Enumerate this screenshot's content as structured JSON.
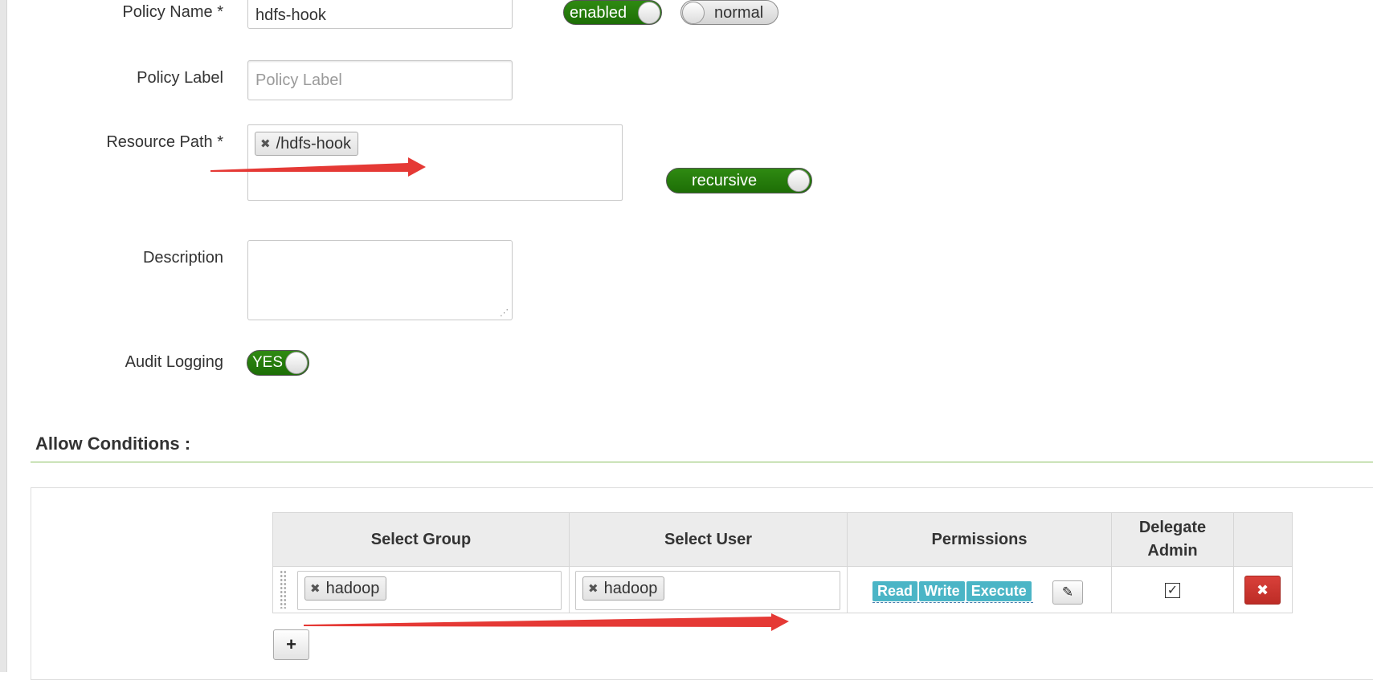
{
  "form": {
    "policy_name": {
      "label": "Policy Name *",
      "value": "hdfs-hook"
    },
    "policy_status_toggle": {
      "label": "enabled",
      "state": "on"
    },
    "policy_type_toggle": {
      "label": "normal",
      "state": "off"
    },
    "policy_label": {
      "label": "Policy Label",
      "placeholder": "Policy Label"
    },
    "resource_path": {
      "label": "Resource Path *",
      "tags": [
        "/hdfs-hook"
      ]
    },
    "recursive_toggle": {
      "label": "recursive",
      "state": "on"
    },
    "description": {
      "label": "Description",
      "value": ""
    },
    "audit_logging": {
      "label": "Audit Logging",
      "toggle_label": "YES",
      "state": "on"
    }
  },
  "allow_conditions": {
    "title": "Allow Conditions :",
    "columns": [
      "Select Group",
      "Select User",
      "Permissions",
      "Delegate Admin",
      ""
    ],
    "rows": [
      {
        "group_tags": [
          "hadoop"
        ],
        "user_tags": [
          "hadoop"
        ],
        "permissions": [
          "Read",
          "Write",
          "Execute"
        ],
        "delegate_admin_checked": true
      }
    ],
    "add_button_label": "+"
  },
  "colors": {
    "toggle_on": "#2f8a12",
    "permission_badge": "#4bb5c6",
    "delete_button": "#d9403a",
    "section_rule": "#8bbf60",
    "annotation_arrow": "#e53935"
  },
  "icons": {
    "remove_tag": "close-icon",
    "edit_permissions": "pencil-icon",
    "delete_row": "close-icon",
    "add_row": "plus-icon",
    "drag": "drag-handle-icon"
  }
}
